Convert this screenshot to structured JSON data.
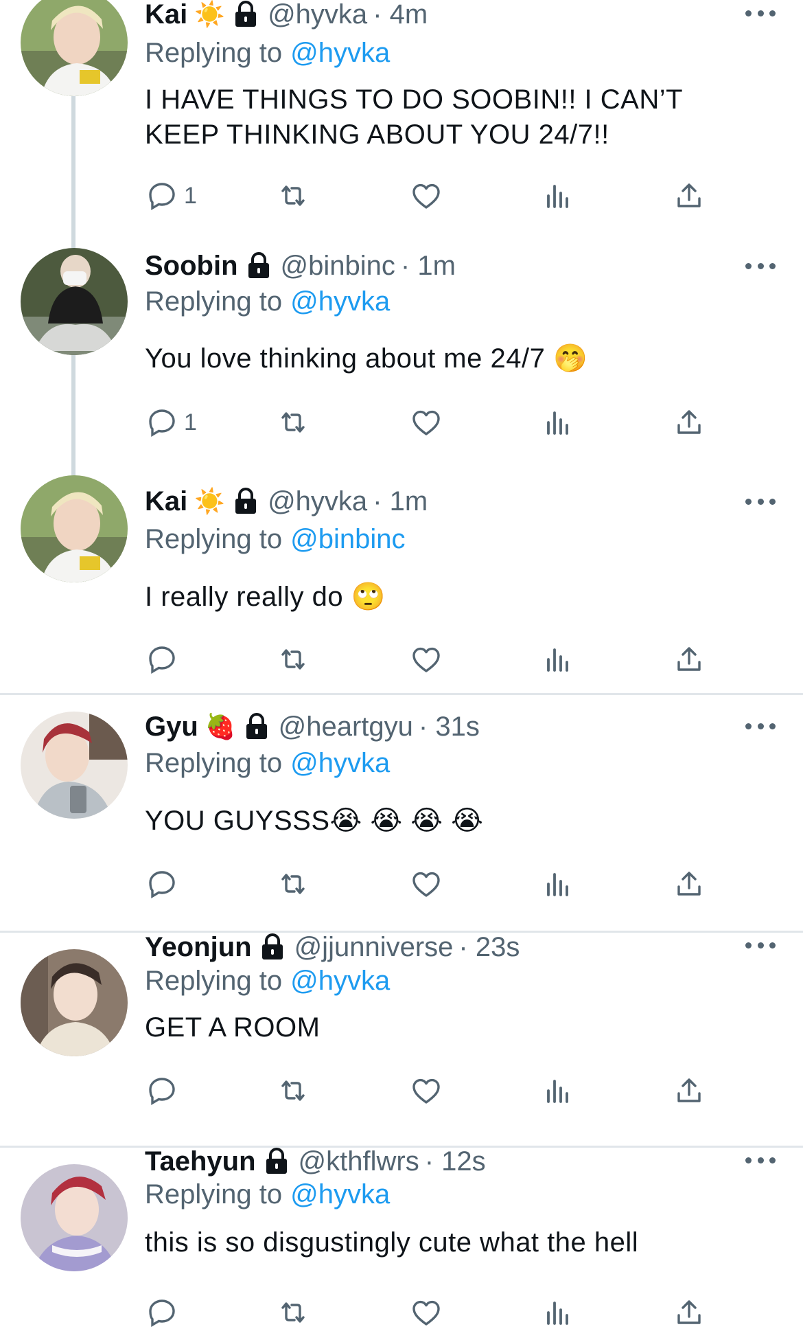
{
  "colors": {
    "accent": "#1d9bf0",
    "muted": "#536471",
    "text": "#0f1419",
    "divider": "#e1e6ea",
    "thread": "#cfd9de"
  },
  "icons": [
    "reply-icon",
    "retweet-icon",
    "like-icon",
    "views-icon",
    "share-icon",
    "lock-icon",
    "more-icon"
  ],
  "tweets": [
    {
      "name": "Kai",
      "badge": "☀️",
      "handle": "@hyvka",
      "time": "· 4m",
      "reply_prefix": "Replying to",
      "reply_to": "@hyvka",
      "text": "I HAVE THINGS TO DO SOOBIN!! I CAN’T KEEP THINKING ABOUT YOU 24/7!!",
      "reply_count": "1"
    },
    {
      "name": "Soobin",
      "badge": "",
      "handle": "@binbinc",
      "time": "· 1m",
      "reply_prefix": "Replying to",
      "reply_to": "@hyvka",
      "text": "You love thinking about me 24/7 🤭",
      "reply_count": "1"
    },
    {
      "name": "Kai",
      "badge": "☀️",
      "handle": "@hyvka",
      "time": "· 1m",
      "reply_prefix": "Replying to",
      "reply_to": "@binbinc",
      "text": "I really really do 🙄",
      "reply_count": ""
    },
    {
      "name": "Gyu",
      "badge": "🍓",
      "handle": "@heartgyu",
      "time": "· 31s",
      "reply_prefix": "Replying to",
      "reply_to": "@hyvka",
      "text": "YOU GUYSSS😭 😭 😭 😭",
      "reply_count": ""
    },
    {
      "name": "Yeonjun",
      "badge": "",
      "handle": "@jjunniverse",
      "time": "· 23s",
      "reply_prefix": "Replying to",
      "reply_to": "@hyvka",
      "text": "GET A ROOM",
      "reply_count": ""
    },
    {
      "name": "Taehyun",
      "badge": "",
      "handle": "@kthflwrs",
      "time": "· 12s",
      "reply_prefix": "Replying to",
      "reply_to": "@hyvka",
      "text": "this is so disgustingly cute what the hell",
      "reply_count": ""
    }
  ]
}
